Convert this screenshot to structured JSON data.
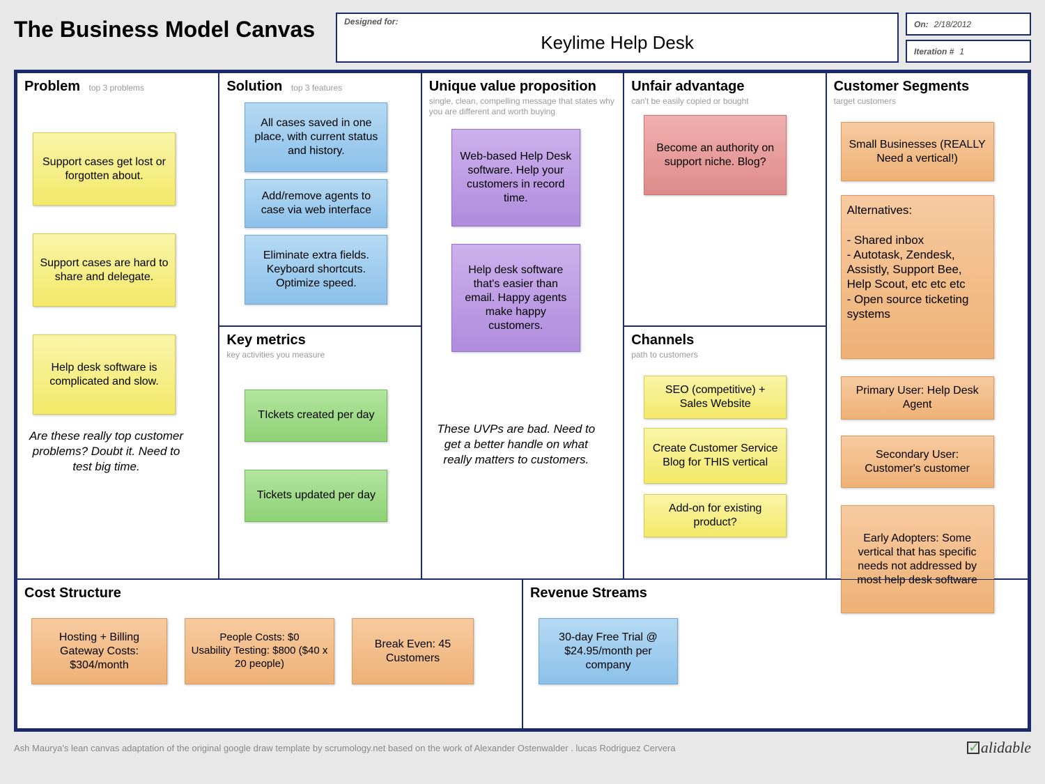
{
  "header": {
    "title": "The Business Model Canvas",
    "designed_label": "Designed for:",
    "designed_value": "Keylime Help Desk",
    "on_label": "On:",
    "on_value": "2/18/2012",
    "iteration_label": "Iteration #",
    "iteration_value": "1"
  },
  "sections": {
    "problem": {
      "title": "Problem",
      "subtitle": "top 3 problems"
    },
    "solution": {
      "title": "Solution",
      "subtitle": "top 3 features"
    },
    "metrics": {
      "title": "Key metrics",
      "subtitle": "key activities you measure"
    },
    "uvp": {
      "title": "Unique value proposition",
      "subtitle": "single, clean, compelling message that states why you are different and worth buying"
    },
    "advantage": {
      "title": "Unfair advantage",
      "subtitle": "can't be easily copied or bought"
    },
    "channels": {
      "title": "Channels",
      "subtitle": "path to customers"
    },
    "segments": {
      "title": "Customer Segments",
      "subtitle": "target customers"
    },
    "cost": {
      "title": "Cost Structure"
    },
    "revenue": {
      "title": "Revenue Streams"
    }
  },
  "notes": {
    "problem": [
      "Support cases get lost or forgotten about.",
      "Support cases are hard to share and delegate.",
      "Help desk software is complicated and slow."
    ],
    "problem_comment": "Are these really top customer problems? Doubt it.  Need to test big time.",
    "solution": [
      "All cases saved in one place, with current status and history.",
      "Add/remove agents to case via web interface",
      "Eliminate extra fields. Keyboard shortcuts. Optimize speed."
    ],
    "metrics": [
      "TIckets created per day",
      "Tickets updated per day"
    ],
    "uvp": [
      "Web-based Help Desk software. Help your customers in record time.",
      "Help desk software that's easier than email. Happy agents make happy customers."
    ],
    "uvp_comment": "These UVPs are bad. Need to get a better handle on what really matters to customers.",
    "advantage": [
      "Become an authority on support niche. Blog?"
    ],
    "channels": [
      "SEO (competitive) + Sales Website",
      "Create Customer Service Blog for THIS vertical",
      "Add-on for existing product?"
    ],
    "segments": [
      "Small Businesses (REALLY Need a vertical!)",
      "Alternatives:\n\n- Shared inbox\n- Autotask, Zendesk, Assistly, Support Bee, Help Scout, etc etc etc\n- Open source ticketing systems",
      "Primary User: Help Desk Agent",
      "Secondary User: Customer's customer",
      "Early Adopters: Some vertical that has specific needs not addressed by most help desk software"
    ],
    "cost": [
      "Hosting + Billing Gateway Costs: $304/month",
      "People Costs:  $0\nUsability Testing: $800 ($40 x 20 people)",
      "Break Even:  45 Customers"
    ],
    "revenue": [
      "30-day Free Trial @ $24.95/month per company"
    ]
  },
  "footer": {
    "credit": "Ash Maurya's lean canvas adaptation of the original google draw template by scrumology.net based on the work of Alexander Ostenwalder . lucas Rodriguez Cervera",
    "logo": "alidable"
  }
}
